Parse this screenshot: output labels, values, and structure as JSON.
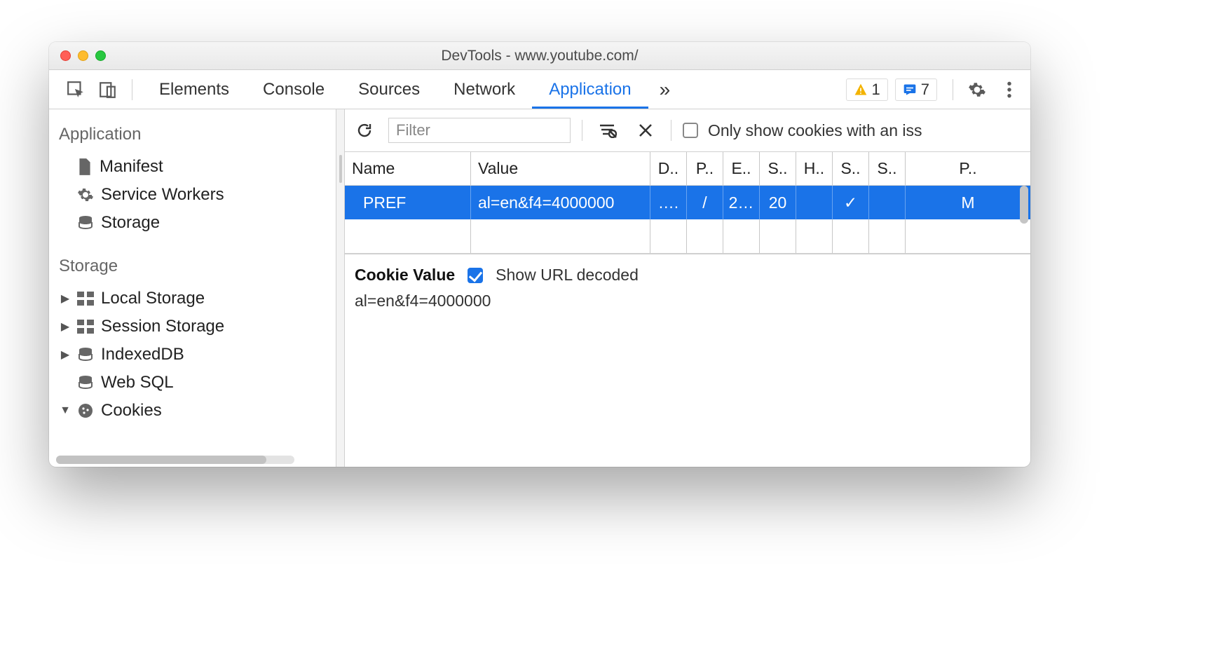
{
  "window": {
    "title": "DevTools - www.youtube.com/"
  },
  "toolbar": {
    "tabs": [
      "Elements",
      "Console",
      "Sources",
      "Network",
      "Application"
    ],
    "active_tab": "Application",
    "warn_count": "1",
    "info_count": "7"
  },
  "sidebar": {
    "sections": [
      {
        "title": "Application",
        "items": [
          {
            "label": "Manifest",
            "icon": "file"
          },
          {
            "label": "Service Workers",
            "icon": "gear"
          },
          {
            "label": "Storage",
            "icon": "db"
          }
        ]
      },
      {
        "title": "Storage",
        "items": [
          {
            "label": "Local Storage",
            "icon": "grid",
            "expandable": true,
            "expanded": false
          },
          {
            "label": "Session Storage",
            "icon": "grid",
            "expandable": true,
            "expanded": false
          },
          {
            "label": "IndexedDB",
            "icon": "db",
            "expandable": true,
            "expanded": false
          },
          {
            "label": "Web SQL",
            "icon": "db",
            "expandable": false
          },
          {
            "label": "Cookies",
            "icon": "cookie",
            "expandable": true,
            "expanded": true
          }
        ]
      }
    ]
  },
  "filterbar": {
    "placeholder": "Filter",
    "only_issue_label": "Only show cookies with an iss"
  },
  "grid": {
    "columns": [
      "Name",
      "Value",
      "D..",
      "P..",
      "E..",
      "S..",
      "H..",
      "S..",
      "S..",
      "P.."
    ],
    "row": {
      "name": "PREF",
      "value": "al=en&f4=4000000",
      "d": "….",
      "p": "/",
      "e": "2…",
      "s": "20",
      "h": "",
      "s2": "✓",
      "s3": "",
      "pr": "M"
    }
  },
  "detail": {
    "heading": "Cookie Value",
    "decoded_label": "Show URL decoded",
    "decoded_checked": true,
    "value": "al=en&f4=4000000"
  }
}
